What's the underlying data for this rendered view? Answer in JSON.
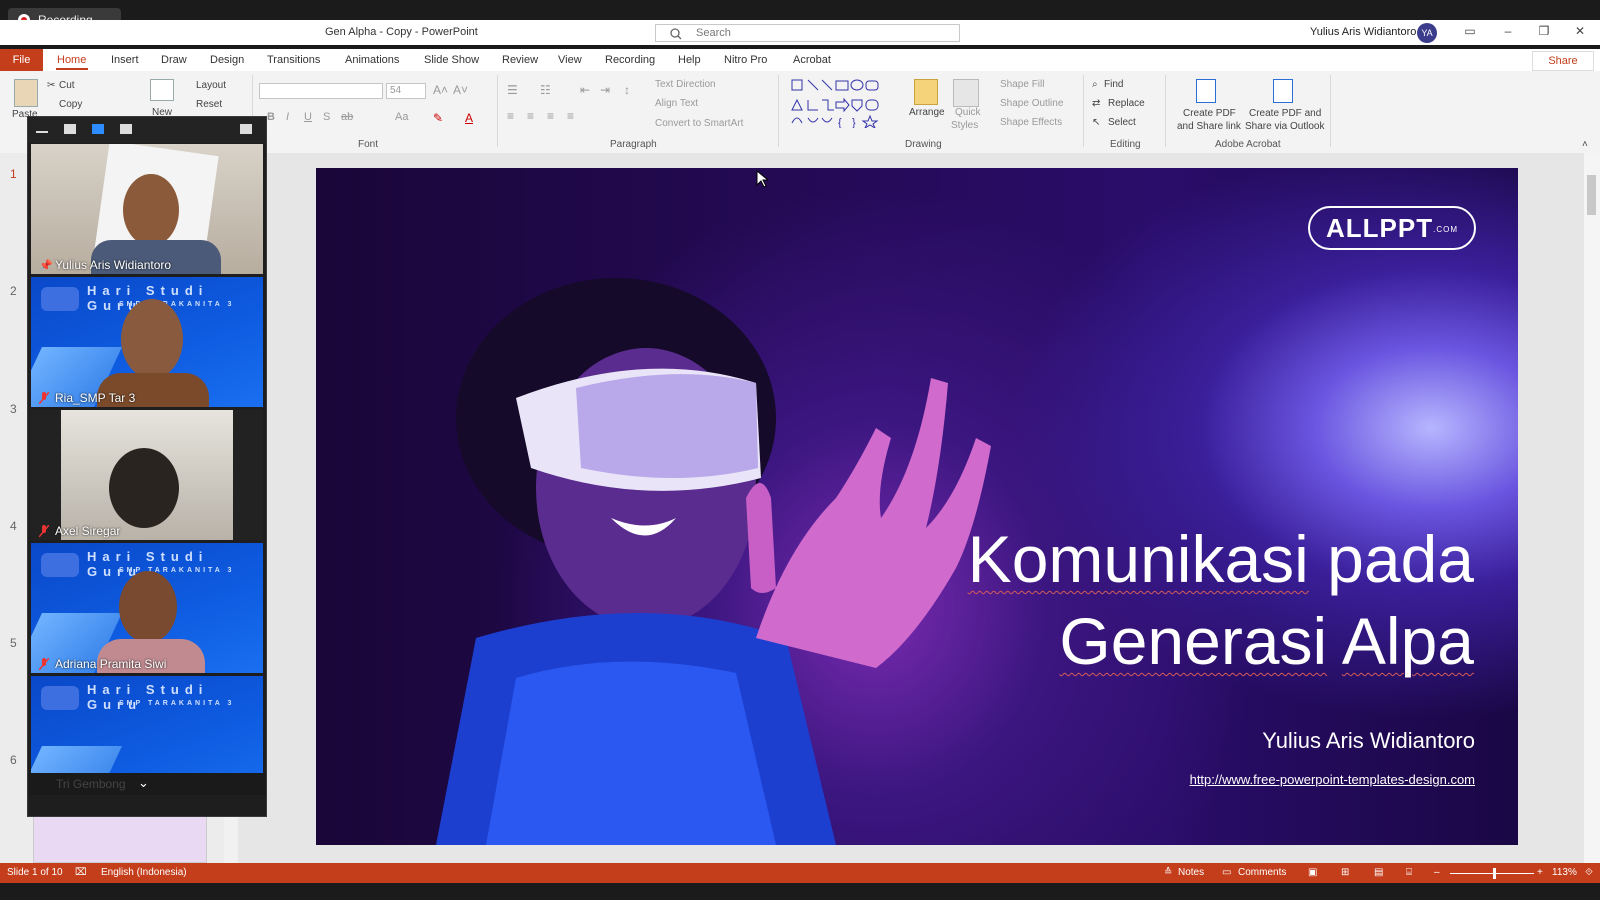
{
  "recording": {
    "label": "Recording..."
  },
  "window": {
    "title": "Gen Alpha - Copy  -  PowerPoint",
    "search_placeholder": "Search",
    "user_name": "Yulius Aris Widiantoro",
    "user_initials": "YA"
  },
  "tabs": [
    {
      "label": "File"
    },
    {
      "label": "Home"
    },
    {
      "label": "Insert"
    },
    {
      "label": "Draw"
    },
    {
      "label": "Design"
    },
    {
      "label": "Transitions"
    },
    {
      "label": "Animations"
    },
    {
      "label": "Slide Show"
    },
    {
      "label": "Review"
    },
    {
      "label": "View"
    },
    {
      "label": "Recording"
    },
    {
      "label": "Help"
    },
    {
      "label": "Nitro Pro"
    },
    {
      "label": "Acrobat"
    }
  ],
  "share_label": "Share",
  "ribbon": {
    "clipboard": {
      "paste": "Paste",
      "cut": "Cut",
      "copy": "Copy"
    },
    "slides": {
      "new": "New",
      "layout": "Layout",
      "reset": "Reset"
    },
    "font": {
      "group": "Font",
      "size": "54"
    },
    "paragraph": {
      "group": "Paragraph",
      "text_direction": "Text Direction",
      "align_text": "Align Text",
      "convert_smartart": "Convert to SmartArt"
    },
    "drawing": {
      "group": "Drawing",
      "arrange": "Arrange",
      "quick_styles_1": "Quick",
      "quick_styles_2": "Styles",
      "shape_fill": "Shape Fill",
      "shape_outline": "Shape Outline",
      "shape_effects": "Shape Effects"
    },
    "editing": {
      "group": "Editing",
      "find": "Find",
      "replace": "Replace",
      "select": "Select"
    },
    "acrobat": {
      "group": "Adobe Acrobat",
      "create_share_1": "Create PDF",
      "create_share_2": "and Share link",
      "create_outlook_1": "Create PDF and",
      "create_outlook_2": "Share via Outlook"
    }
  },
  "thumbnails": [
    "1",
    "2",
    "3",
    "4",
    "5",
    "6"
  ],
  "participants": [
    {
      "name": "Yulius Aris Widiantoro",
      "muted": false,
      "pinned": true
    },
    {
      "name": "Ria_SMP Tar 3",
      "muted": true
    },
    {
      "name": "Axel Siregar",
      "muted": true
    },
    {
      "name": "Adriana Pramita Siwi",
      "muted": true
    },
    {
      "name": "Tri Gembong",
      "muted": true
    }
  ],
  "banner": {
    "title": "Hari Studi Guru",
    "subtitle": "SMP TARAKANITA 3"
  },
  "slide": {
    "logo_main": "ALLPPT",
    "logo_suffix": ".COM",
    "title_line1_word1": "Komunikasi",
    "title_line1_word2": "pada",
    "title_line2_word1": "Generasi",
    "title_line2_word2": "Alpa",
    "author": "Yulius Aris Widiantoro",
    "url": "http://www.free-powerpoint-templates-design.com"
  },
  "status": {
    "slide": "Slide 1 of 10",
    "language": "English (Indonesia)",
    "notes": "Notes",
    "comments": "Comments",
    "zoom": "113%",
    "zoom_level_percent": 113
  },
  "colors": {
    "accent": "#c43e1c",
    "zoom_bg": "#1e1e1e",
    "banner": "#0e5be0"
  }
}
